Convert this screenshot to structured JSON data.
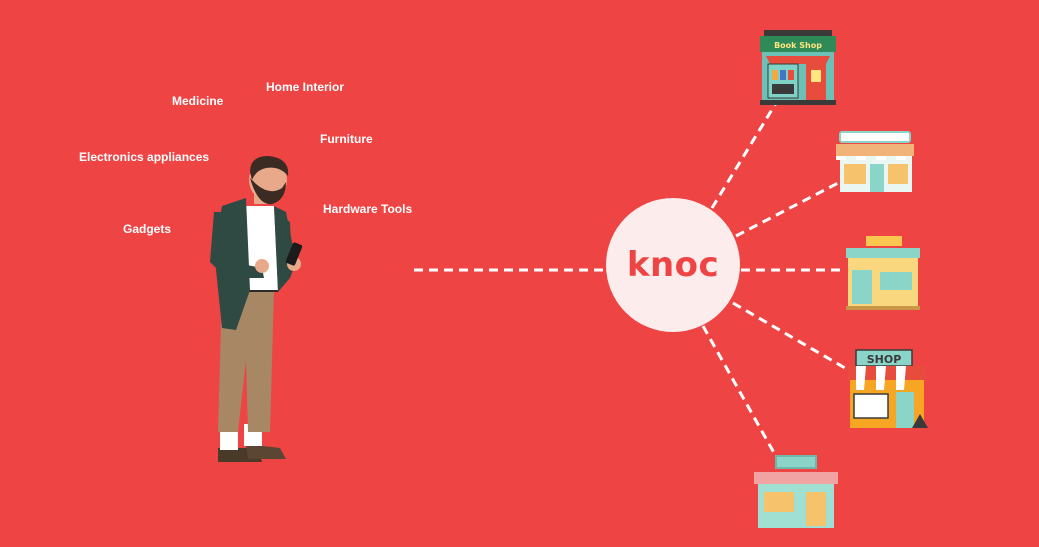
{
  "categories": {
    "home_interior": "Home Interior",
    "medicine": "Medicine",
    "furniture": "Furniture",
    "electronics": "Electronics appliances",
    "hardware": "Hardware Tools",
    "gadgets": "Gadgets"
  },
  "hub": {
    "label": "knoc"
  },
  "shops": {
    "book_shop_sign": "Book Shop",
    "shop_sign": "SHOP"
  },
  "colors": {
    "background": "#ef4444",
    "hub_fill": "#fdecec",
    "accent_text": "#ef4444",
    "connector": "#ffffff"
  }
}
